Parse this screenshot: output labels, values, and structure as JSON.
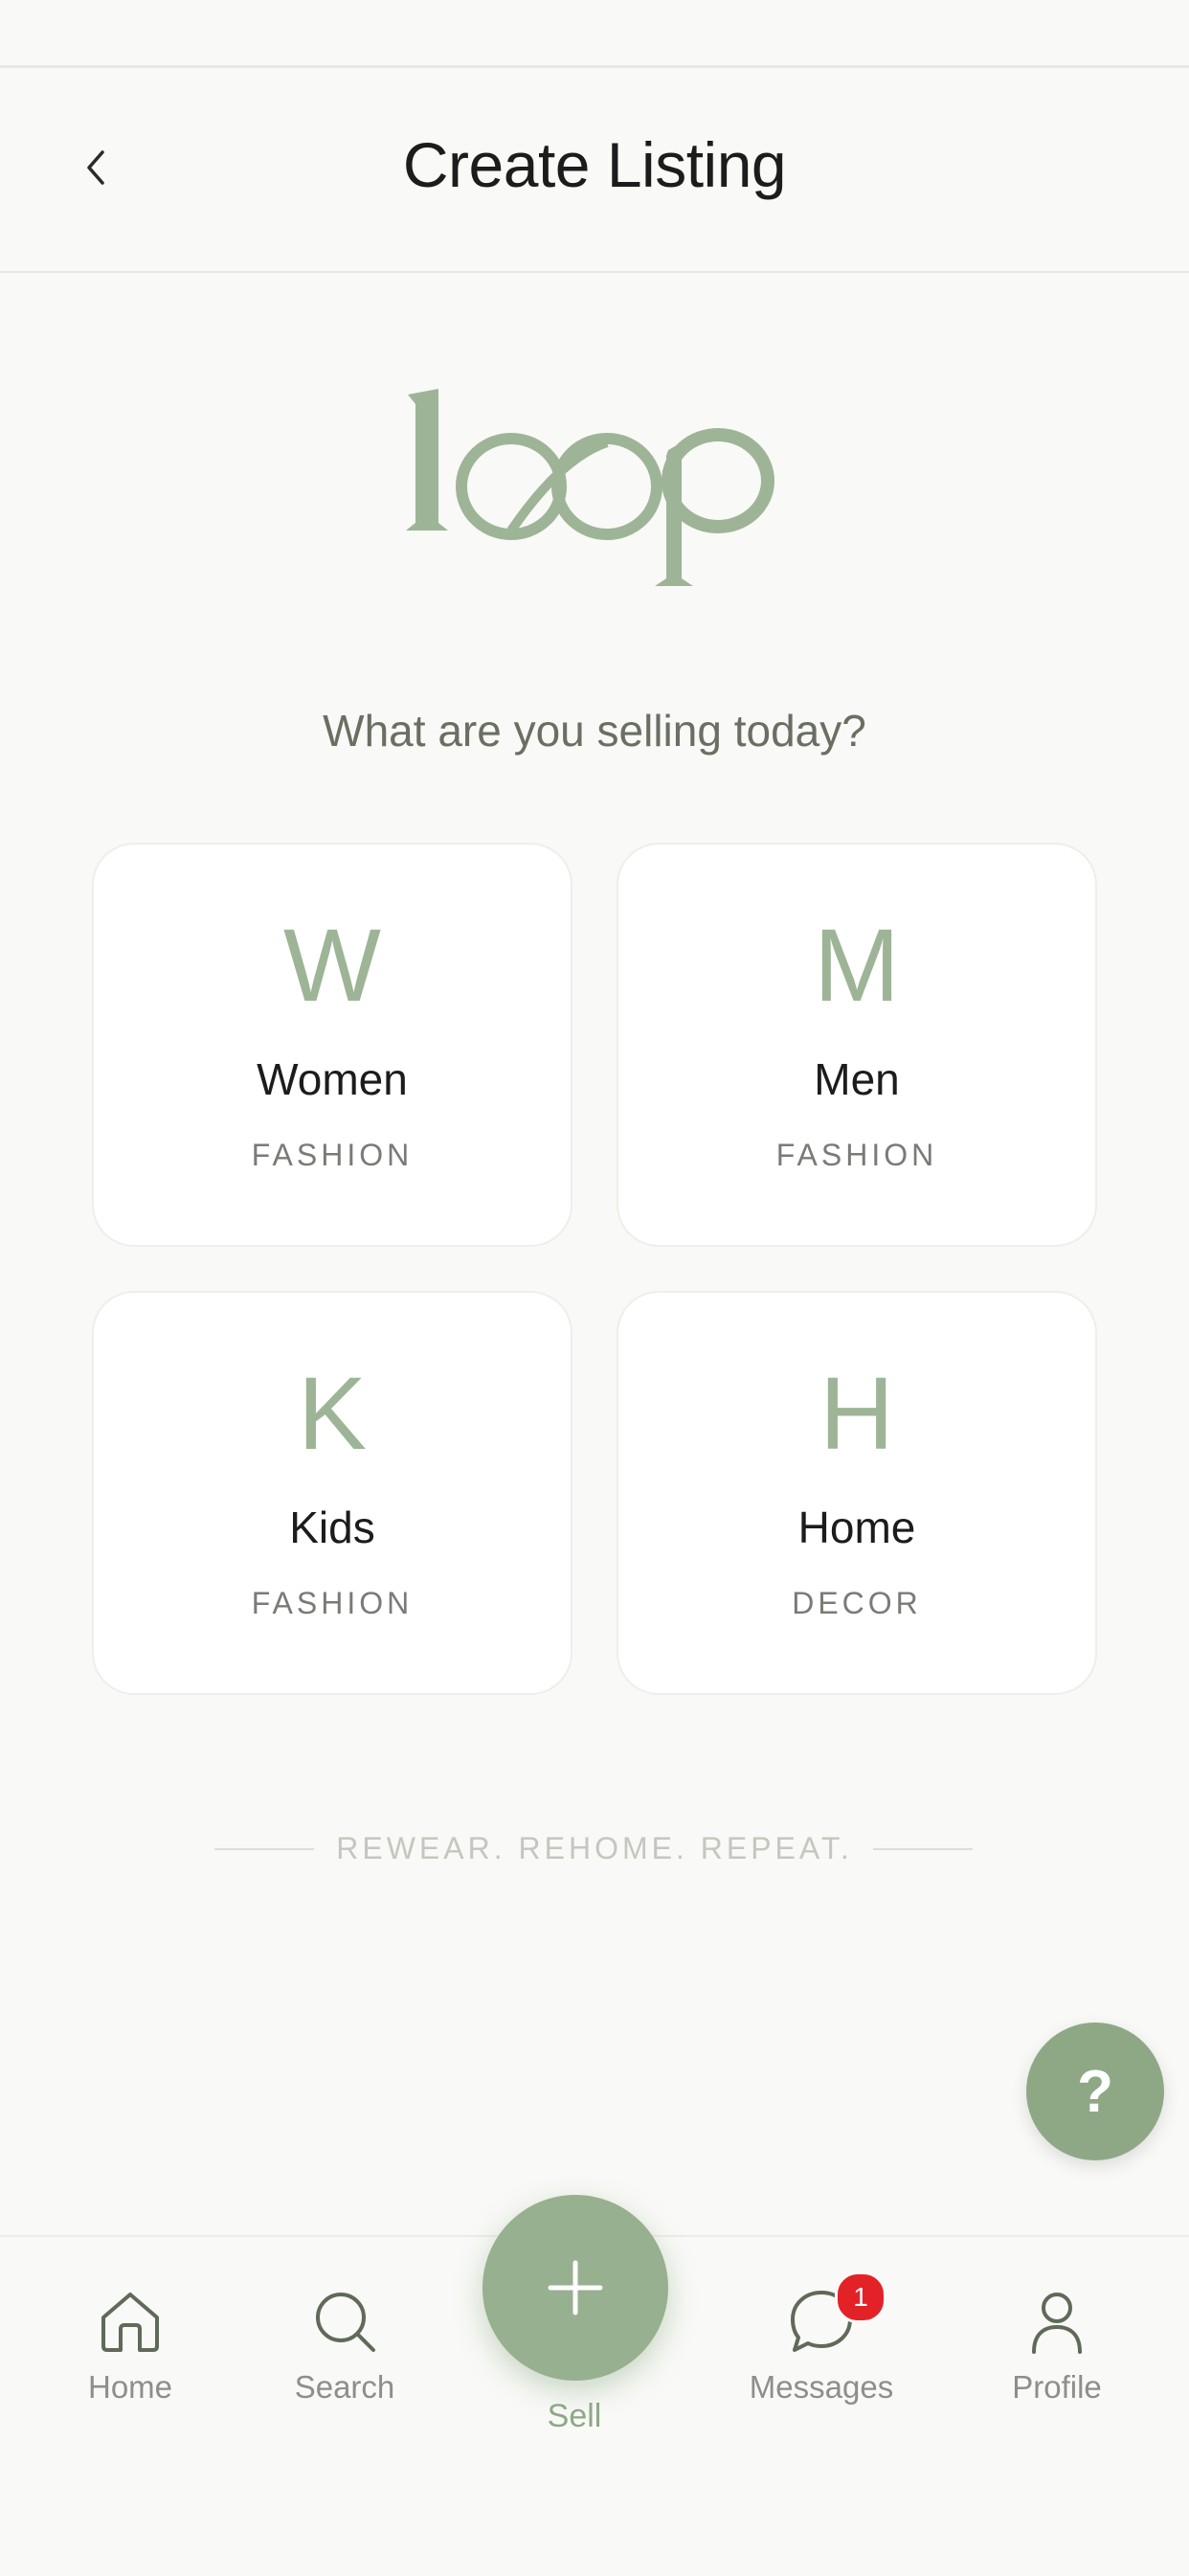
{
  "header": {
    "title": "Create Listing"
  },
  "logo": {
    "text": "loop",
    "color": "#9eb496"
  },
  "prompt": "What are you selling today?",
  "categories": [
    {
      "letter": "W",
      "name": "Women",
      "sub": "FASHION"
    },
    {
      "letter": "M",
      "name": "Men",
      "sub": "FASHION"
    },
    {
      "letter": "K",
      "name": "Kids",
      "sub": "FASHION"
    },
    {
      "letter": "H",
      "name": "Home",
      "sub": "DECOR"
    }
  ],
  "tagline": "REWEAR. REHOME. REPEAT.",
  "help": {
    "label": "?"
  },
  "tabbar": {
    "home": "Home",
    "search": "Search",
    "sell": "Sell",
    "messages": "Messages",
    "messages_badge": "1",
    "profile": "Profile"
  },
  "colors": {
    "accent": "#8ea886",
    "badge": "#e32227",
    "background": "#f9f9f7"
  }
}
